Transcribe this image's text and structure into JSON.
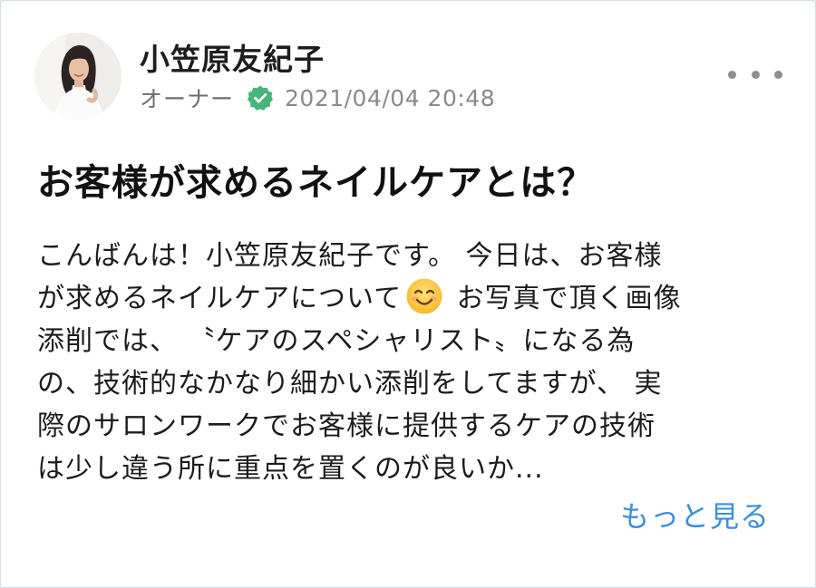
{
  "post": {
    "author_name": "小笠原友紀子",
    "author_role": "オーナー",
    "timestamp": "2021/04/04 20:48",
    "title": "お客様が求めるネイルケアとは？",
    "body_lines": [
      "こんばんは！小笠原友紀子です。 今日は、お客様",
      "が求めるネイルケアについて",
      " お写真で頂く画像",
      "添削では、 〝ケアのスペシャリスト〟になる為",
      "の、技術的なかなり細かい添削をしてますが、 実",
      "際のサロンワークでお客様に提供するケアの技術",
      "は少し違う所に重点を置くのが良いか..."
    ],
    "read_more_label": "もっと見る"
  },
  "icons": {
    "verified": "verified-check-badge",
    "more": "more-horizontal-dots",
    "emoji": "smiling-face-emoji"
  },
  "colors": {
    "verified_badge": "#45b57a",
    "link": "#3d8edc",
    "meta_text": "#8a8a8a"
  }
}
